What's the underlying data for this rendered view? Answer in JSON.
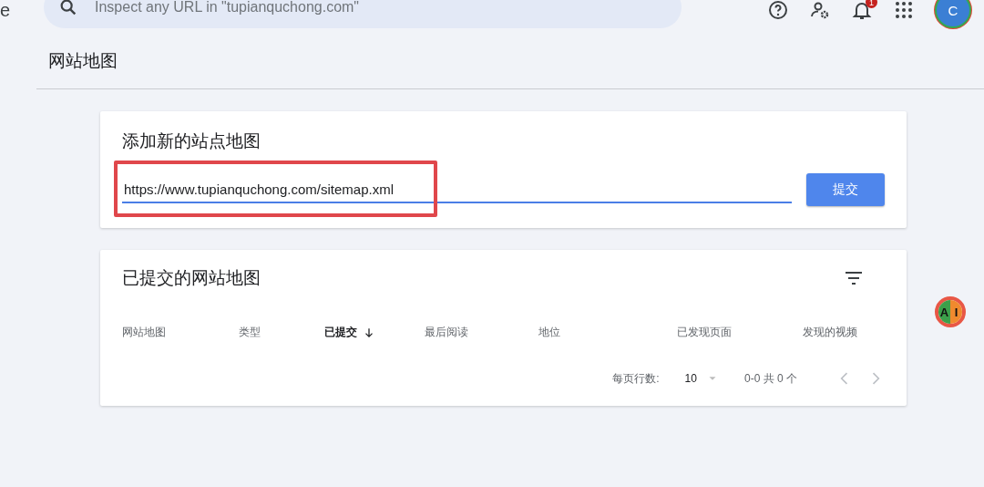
{
  "left_edge_text": "e",
  "search": {
    "placeholder": "Inspect any URL in \"tupianquchong.com\""
  },
  "header_icons": [
    {
      "kind": "help"
    },
    {
      "kind": "admin"
    },
    {
      "kind": "bell",
      "badge": "1"
    },
    {
      "kind": "apps"
    }
  ],
  "avatar": {
    "initial": "C"
  },
  "page_title": "网站地图",
  "add_card": {
    "title": "添加新的站点地图",
    "value": "https://www.tupianquchong.com/sitemap.xml",
    "highlighted": true,
    "submit": "提交"
  },
  "submitted_card": {
    "title": "已提交的网站地图",
    "columns": [
      {
        "label": "网站地图",
        "sorted": false
      },
      {
        "label": "类型",
        "sorted": false
      },
      {
        "label": "已提交",
        "sorted": true
      },
      {
        "label": "最后阅读",
        "sorted": false
      },
      {
        "label": "地位",
        "sorted": false
      },
      {
        "label": "已发现页面",
        "sorted": false
      },
      {
        "label": "发现的视频",
        "sorted": false
      }
    ],
    "rows_per_page_label": "每页行数:",
    "rows_per_page": "10",
    "range": "0-0 共 0 个"
  },
  "ai_badge": {
    "letters": [
      "A",
      "I"
    ]
  }
}
